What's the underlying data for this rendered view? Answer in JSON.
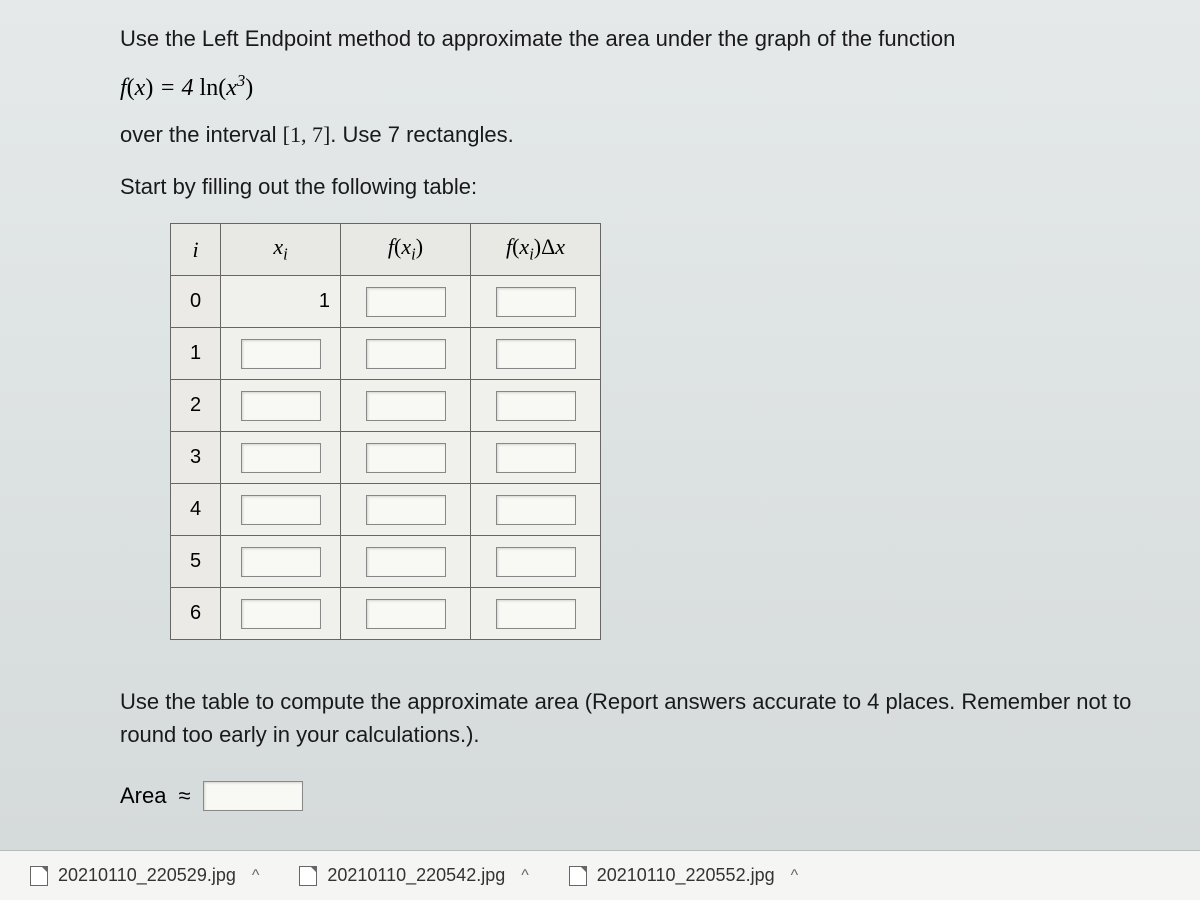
{
  "problem": {
    "intro": "Use the Left Endpoint method to approximate the area under the graph of the function",
    "function_html": "f(x) = 4 ln(x³)",
    "interval_text_pre": "over the interval ",
    "interval": "[1, 7]",
    "interval_text_post": ". Use 7 rectangles.",
    "table_prompt": "Start by filling out the following table:",
    "compute_prompt": "Use the table to compute the approximate area (Report answers accurate to 4 places. Remember not to round too early in your calculations.).",
    "area_label": "Area",
    "approx_symbol": "≈"
  },
  "table": {
    "headers": {
      "i": "i",
      "xi": "xᵢ",
      "fxi": "f(xᵢ)",
      "fxidx": "f(xᵢ)Δx"
    },
    "rows": [
      {
        "i": "0",
        "xi": "1",
        "xi_editable": false
      },
      {
        "i": "1",
        "xi": "",
        "xi_editable": true
      },
      {
        "i": "2",
        "xi": "",
        "xi_editable": true
      },
      {
        "i": "3",
        "xi": "",
        "xi_editable": true
      },
      {
        "i": "4",
        "xi": "",
        "xi_editable": true
      },
      {
        "i": "5",
        "xi": "",
        "xi_editable": true
      },
      {
        "i": "6",
        "xi": "",
        "xi_editable": true
      }
    ]
  },
  "downloads": [
    {
      "name": "20210110_220529.jpg"
    },
    {
      "name": "20210110_220542.jpg"
    },
    {
      "name": "20210110_220552.jpg"
    }
  ]
}
